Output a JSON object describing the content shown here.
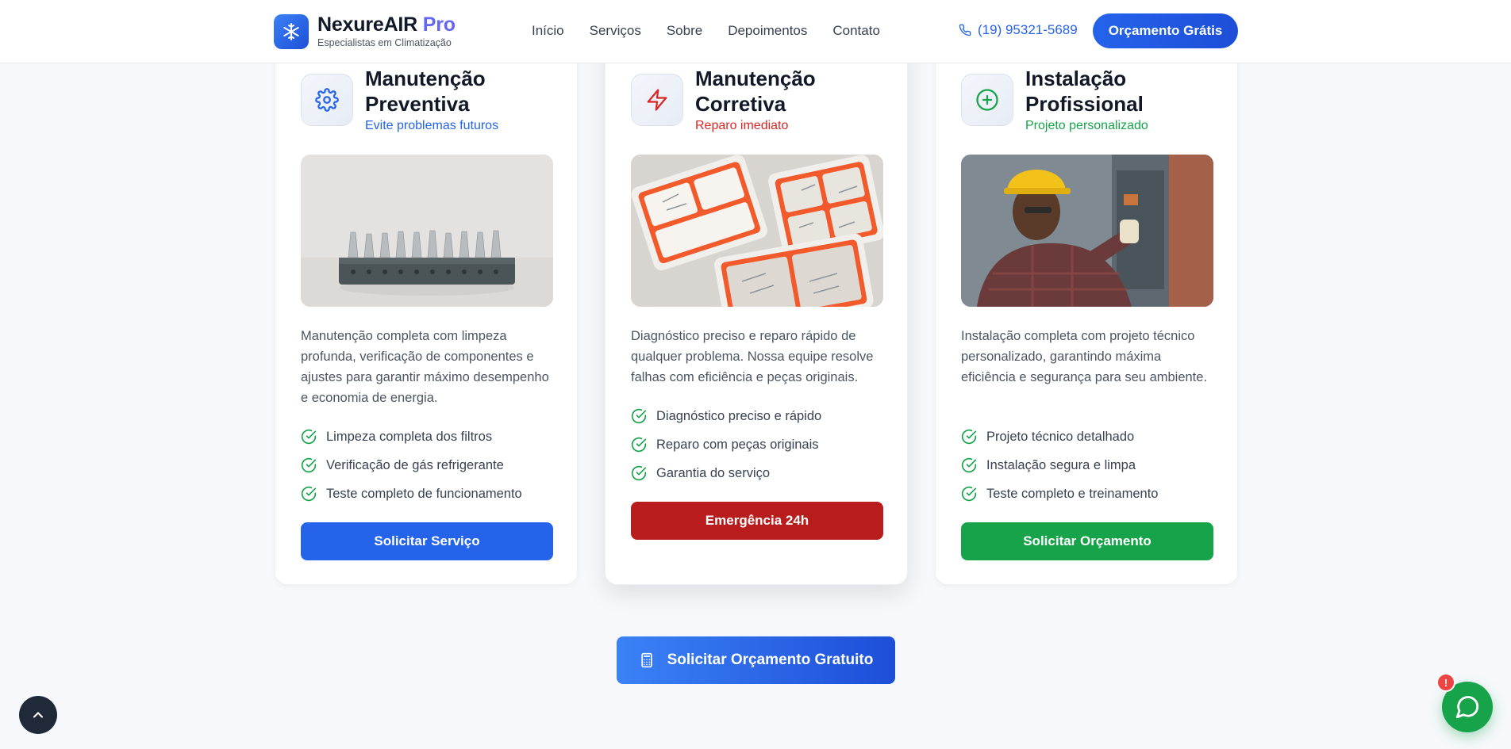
{
  "header": {
    "brand": "NexureAIR",
    "brand_suffix": "Pro",
    "tagline": "Especialistas em Climatização",
    "nav": [
      "Início",
      "Serviços",
      "Sobre",
      "Depoimentos",
      "Contato"
    ],
    "phone": "(19) 95321-5689",
    "cta": "Orçamento Grátis"
  },
  "cards": [
    {
      "title": "Manutenção Preventiva",
      "subtitle": "Evite problemas futuros",
      "accent": "#2563eb",
      "icon": "gear-icon",
      "description": "Manutenção completa com limpeza profunda, verificação de componentes e ajustes para garantir máximo desempenho e economia de energia.",
      "features": [
        "Limpeza completa dos filtros",
        "Verificação de gás refrigerante",
        "Teste completo de funcionamento"
      ],
      "button": "Solicitar Serviço"
    },
    {
      "title": "Manutenção Corretiva",
      "subtitle": "Reparo imediato",
      "accent": "#dc2626",
      "icon": "lightning-icon",
      "description": "Diagnóstico preciso e reparo rápido de qualquer problema. Nossa equipe resolve falhas com eficiência e peças originais.",
      "features": [
        "Diagnóstico preciso e rápido",
        "Reparo com peças originais",
        "Garantia do serviço"
      ],
      "button": "Emergência 24h"
    },
    {
      "title": "Instalação Profissional",
      "subtitle": "Projeto personalizado",
      "accent": "#16a34a",
      "icon": "plus-circle-icon",
      "description": "Instalação completa com projeto técnico personalizado, garantindo máxima eficiência e segurança para seu ambiente.",
      "features": [
        "Projeto técnico detalhado",
        "Instalação segura e limpa",
        "Teste completo e treinamento"
      ],
      "button": "Solicitar Orçamento"
    }
  ],
  "cta": "Solicitar Orçamento Gratuito",
  "whatsapp_badge": "!"
}
